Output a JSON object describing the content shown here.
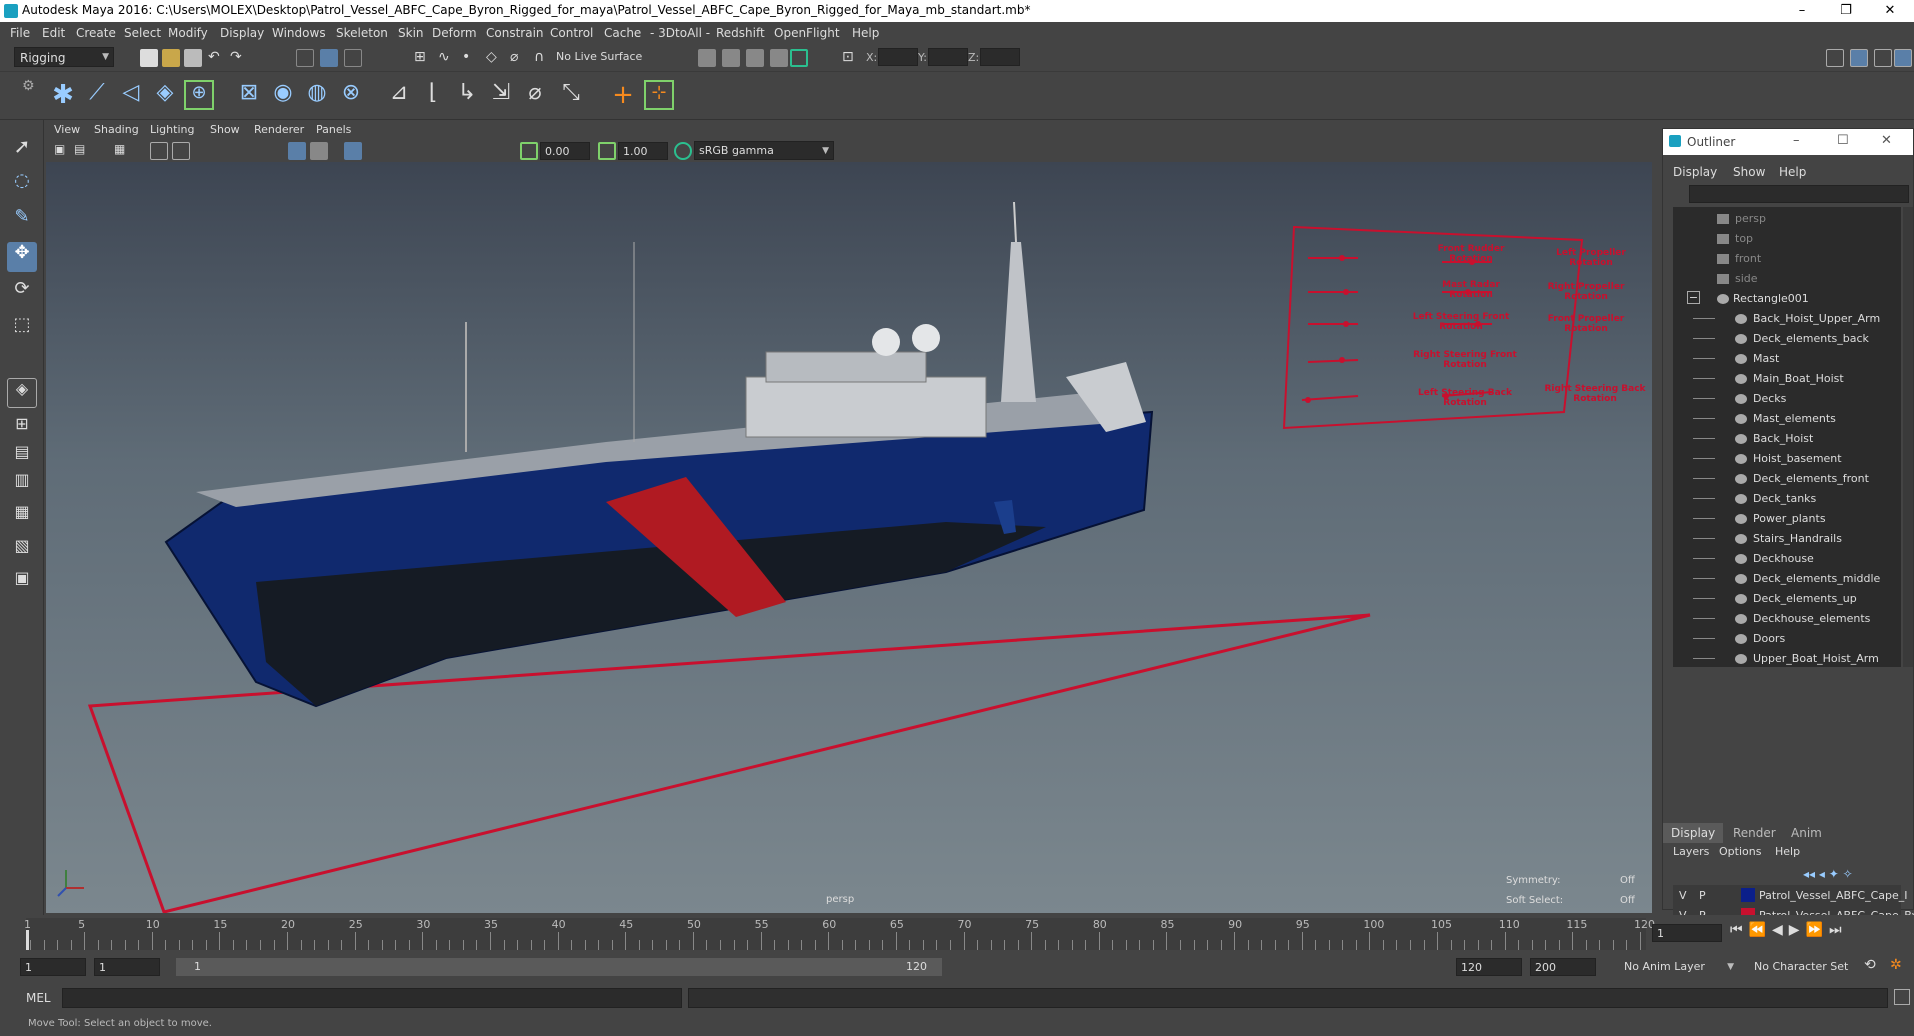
{
  "window": {
    "title": "Autodesk Maya 2016: C:\\Users\\MOLEX\\Desktop\\Patrol_Vessel_ABFC_Cape_Byron_Rigged_for_maya\\Patrol_Vessel_ABFC_Cape_Byron_Rigged_for_Maya_mb_standart.mb*",
    "minimize": "–",
    "restore": "❐",
    "close": "✕"
  },
  "menubar": [
    "File",
    "Edit",
    "Create",
    "Select",
    "Modify",
    "Display",
    "Windows",
    "Skeleton",
    "Skin",
    "Deform",
    "Constrain",
    "Control",
    "Cache",
    "- 3DtoAll -",
    "Redshift",
    "OpenFlight",
    "Help"
  ],
  "statusline": {
    "menuset": "Rigging",
    "live_surface": "No Live Surface",
    "x_label": "X:",
    "y_label": "Y:",
    "z_label": "Z:"
  },
  "viewport": {
    "menus": [
      "View",
      "Shading",
      "Lighting",
      "Show",
      "Renderer",
      "Panels"
    ],
    "near_value": "0.00",
    "far_value": "1.00",
    "color_space": "sRGB gamma",
    "camera_label": "persp",
    "symmetry_label": "Symmetry:",
    "symmetry_value": "Off",
    "soft_select_label": "Soft Select:",
    "soft_select_value": "Off",
    "control_board_labels": [
      "Front Rudder Rotation",
      "Left Propeller Rotation",
      "Mast Radar Rotation",
      "Right Propeller Rotation",
      "Left Steering Front Rotation",
      "Front Propeller Rotation",
      "Right Steering Front Rotation",
      "Left Steering Back Rotation",
      "Right Steering Back Rotation"
    ]
  },
  "outliner": {
    "title": "Outliner",
    "menus": [
      "Display",
      "Show",
      "Help"
    ],
    "cameras": [
      "persp",
      "top",
      "front",
      "side"
    ],
    "root": "Rectangle001",
    "children": [
      "Back_Hoist_Upper_Arm",
      "Deck_elements_back",
      "Mast",
      "Main_Boat_Hoist",
      "Decks",
      "Mast_elements",
      "Back_Hoist",
      "Hoist_basement",
      "Deck_elements_front",
      "Deck_tanks",
      "Power_plants",
      "Stairs_Handrails",
      "Deckhouse",
      "Deck_elements_middle",
      "Deck_elements_up",
      "Deckhouse_elements",
      "Doors",
      "Upper_Boat_Hoist_Arm"
    ]
  },
  "layer_editor": {
    "tabs": [
      "Display",
      "Render",
      "Anim"
    ],
    "menus": [
      "Layers",
      "Options",
      "Help"
    ],
    "layers": [
      {
        "v": "V",
        "p": "P",
        "name": "Patrol_Vessel_ABFC_Cape_I",
        "color": "#0b1f8a"
      },
      {
        "v": "V",
        "p": "P",
        "name": "Patrol_Vessel_ABFC_Cape_By",
        "color": "#c8102e"
      }
    ]
  },
  "timeline": {
    "ticks": [
      "1",
      "5",
      "10",
      "15",
      "20",
      "25",
      "30",
      "35",
      "40",
      "45",
      "50",
      "55",
      "60",
      "65",
      "70",
      "75",
      "80",
      "85",
      "90",
      "95",
      "100",
      "105",
      "110",
      "115",
      "120"
    ],
    "current_frame": "1"
  },
  "range": {
    "start": "1",
    "playback_start": "1",
    "range_start_label": "1",
    "range_end_label": "120",
    "playback_end": "120",
    "end": "200",
    "anim_layer": "No Anim Layer",
    "character_set": "No Character Set"
  },
  "cmdline": {
    "label": "MEL"
  },
  "helpline": {
    "text": "Move Tool: Select an object to move."
  },
  "colors": {
    "hull_blue": "#10296e",
    "stripe_red": "#b01a22",
    "rig_red": "#c8102e",
    "ui_bg": "#444444",
    "field_bg": "#2b2b2b"
  }
}
